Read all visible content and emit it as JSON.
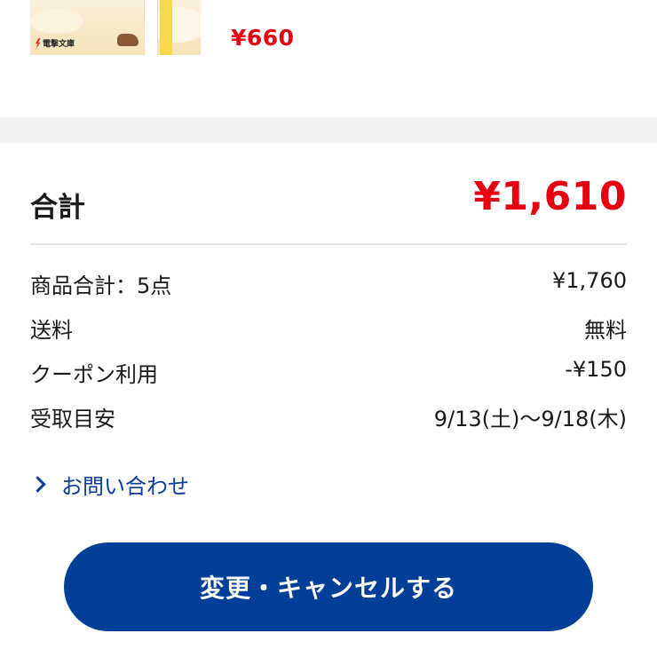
{
  "product": {
    "thumbnail_label": "電撃文庫",
    "price": "¥660"
  },
  "summary": {
    "total_label": "合計",
    "total_value": "¥1,610",
    "rows": [
      {
        "label": "商品合計：5点",
        "value": "¥1,760"
      },
      {
        "label": "送料",
        "value": "無料"
      },
      {
        "label": "クーポン利用",
        "value": "-¥150"
      },
      {
        "label": "受取目安",
        "value": "9/13(土)〜9/18(木)"
      }
    ]
  },
  "links": {
    "inquiry_label": "お問い合わせ"
  },
  "actions": {
    "change_cancel_label": "変更・キャンセルする"
  },
  "colors": {
    "price_red": "#e60012",
    "link_blue": "#0a3e96",
    "button_blue": "#003f98",
    "band_gray": "#f2f2f2"
  },
  "icons": {
    "inquiry": "chevron-right-icon",
    "publisher": "bolt-logo-icon"
  }
}
